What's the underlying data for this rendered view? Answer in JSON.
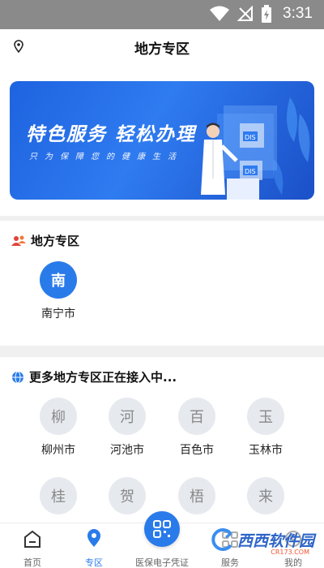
{
  "status_bar": {
    "time": "3:31"
  },
  "header": {
    "title": "地方专区"
  },
  "banner": {
    "headline": "特色服务  轻松办理",
    "subtitle": "只为保障您的健康生活"
  },
  "local_zone": {
    "title": "地方专区",
    "cities": [
      {
        "initial": "南",
        "name": "南宁市"
      }
    ]
  },
  "more_zone": {
    "title": "更多地方专区正在接入中...",
    "cities": [
      {
        "initial": "柳",
        "name": "柳州市"
      },
      {
        "initial": "河",
        "name": "河池市"
      },
      {
        "initial": "百",
        "name": "百色市"
      },
      {
        "initial": "玉",
        "name": "玉林市"
      },
      {
        "initial": "桂",
        "name": ""
      },
      {
        "initial": "贺",
        "name": ""
      },
      {
        "initial": "梧",
        "name": ""
      },
      {
        "initial": "来",
        "name": ""
      }
    ]
  },
  "bottom_nav": {
    "items": [
      {
        "label": "首页"
      },
      {
        "label": "专区"
      },
      {
        "label": "医保电子凭证"
      },
      {
        "label": "服务"
      },
      {
        "label": "我的"
      }
    ]
  },
  "watermark": {
    "text": "西西软件园",
    "url": "CR173.COM"
  },
  "colors": {
    "accent": "#2a7bea",
    "status_bar": "#8a8a8a",
    "local_icon": "#e0433a"
  }
}
